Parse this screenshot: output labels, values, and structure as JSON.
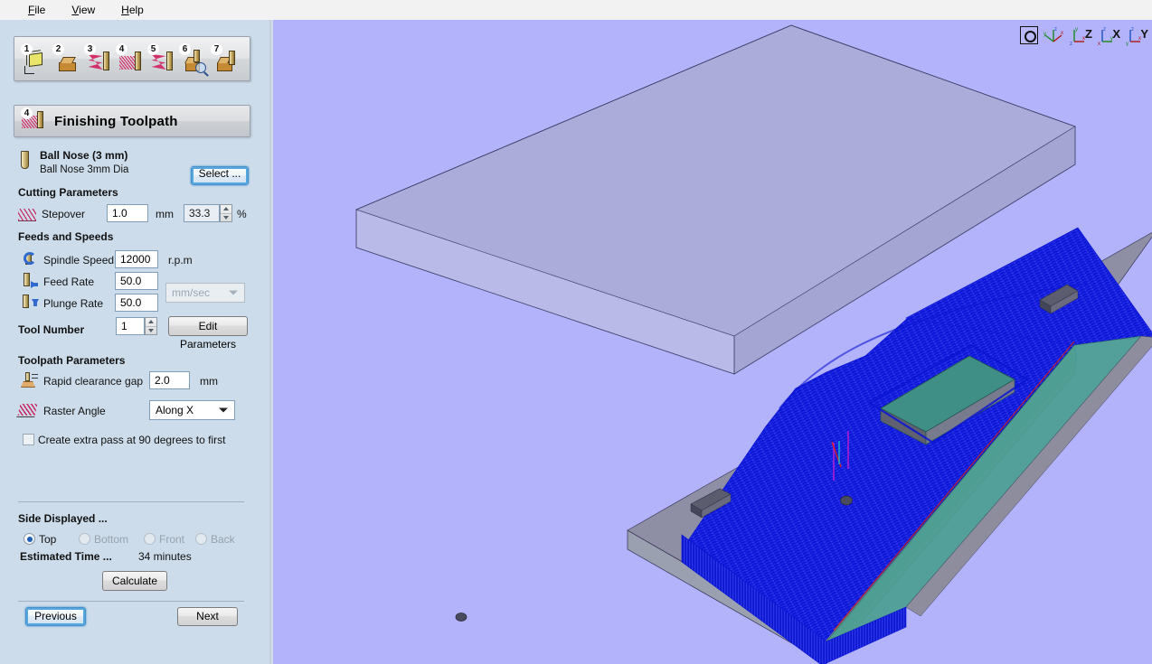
{
  "menubar": {
    "items": [
      {
        "pre": "",
        "acc": "F",
        "post": "ile"
      },
      {
        "pre": "",
        "acc": "V",
        "post": "iew"
      },
      {
        "pre": "",
        "acc": "H",
        "post": "elp"
      }
    ]
  },
  "toolbar": {
    "buttons": [
      {
        "num": "1",
        "name": "material-setup"
      },
      {
        "num": "2",
        "name": "model-block"
      },
      {
        "num": "3",
        "name": "roughing-toolpath"
      },
      {
        "num": "4",
        "name": "finishing-toolpath"
      },
      {
        "num": "5",
        "name": "profile-toolpath"
      },
      {
        "num": "6",
        "name": "preview-toolpath"
      },
      {
        "num": "7",
        "name": "save-toolpath"
      }
    ]
  },
  "header": {
    "badge": "4",
    "title": "Finishing Toolpath"
  },
  "tool": {
    "name": "Ball Nose (3 mm)",
    "description": "Ball Nose 3mm Dia",
    "select_label": "Select ..."
  },
  "cutting": {
    "section_title": "Cutting Parameters",
    "stepover_label": "Stepover",
    "stepover_value": "1.0",
    "stepover_unit": "mm",
    "stepover_percent": "33.3",
    "percent_unit": "%"
  },
  "feeds": {
    "section_title": "Feeds and Speeds",
    "spindle_label": "Spindle Speed",
    "spindle_value": "12000",
    "spindle_unit": "r.p.m",
    "feed_label": "Feed Rate",
    "feed_value": "50.0",
    "plunge_label": "Plunge Rate",
    "plunge_value": "50.0",
    "rate_units_selected": "mm/sec",
    "tool_number_label": "Tool Number",
    "tool_number_value": "1",
    "edit_parameters_label": "Edit Parameters"
  },
  "toolpath": {
    "section_title": "Toolpath Parameters",
    "rapid_gap_label": "Rapid clearance gap",
    "rapid_gap_value": "2.0",
    "rapid_gap_unit": "mm",
    "raster_angle_label": "Raster Angle",
    "raster_angle_selected": "Along X",
    "extra_pass_label": "Create extra pass at 90 degrees to first"
  },
  "side": {
    "section_title": "Side Displayed ...",
    "options": [
      {
        "label": "Top",
        "selected": true,
        "disabled": false
      },
      {
        "label": "Bottom",
        "selected": false,
        "disabled": true
      },
      {
        "label": "Front",
        "selected": false,
        "disabled": true
      },
      {
        "label": "Back",
        "selected": false,
        "disabled": true
      }
    ],
    "estimated_time_label": "Estimated Time ...",
    "estimated_time_value": "34 minutes",
    "calculate_label": "Calculate"
  },
  "nav": {
    "previous_label": "Previous",
    "next_label": "Next"
  },
  "viewtools": {
    "buttons": [
      {
        "name": "fit-view",
        "letter": ""
      },
      {
        "name": "iso-view",
        "letter": ""
      },
      {
        "name": "z-view",
        "letter": "Z"
      },
      {
        "name": "x-view",
        "letter": "X"
      },
      {
        "name": "y-view",
        "letter": "Y"
      }
    ]
  },
  "colors": {
    "viewport_bg": "#b3b3fb",
    "panel_bg": "#ccdcea",
    "toolpath_blue": "#0b15d4",
    "material_gray": "#8d8d9e",
    "material_teal": "#4e9e94",
    "focus_blue": "#55a7e0"
  }
}
